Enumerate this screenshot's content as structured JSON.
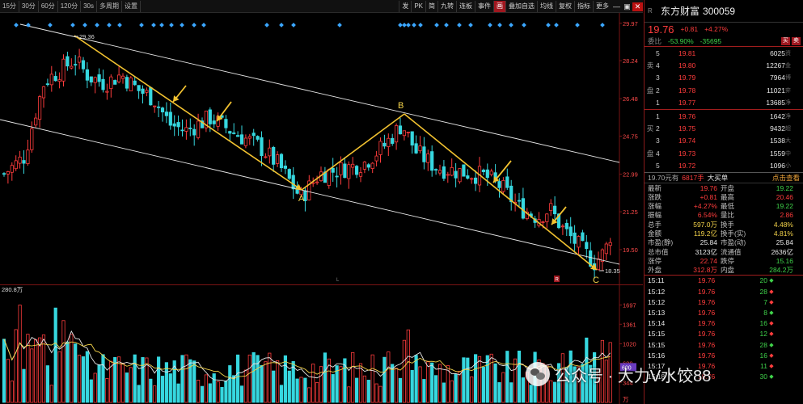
{
  "toolbar": {
    "periods": [
      "15分",
      "30分",
      "60分",
      "120分",
      "30s",
      "多周期",
      "设置"
    ],
    "right_tools": [
      "发",
      "PK",
      "简",
      "九转",
      "连板",
      "事件",
      "画",
      "叠加自选",
      "均线",
      "复权",
      "指标",
      "更多"
    ],
    "highlight_tool": "画"
  },
  "kline": {
    "price_axis": [
      "29.97",
      "28.24",
      "26.48",
      "24.75",
      "22.99",
      "21.25",
      "19.50"
    ],
    "high_label": "29.36",
    "low_label": "18.35",
    "points": {
      "A": "A",
      "B": "B",
      "C": "C"
    },
    "marker_l": "L",
    "marker_r": "R",
    "colors": {
      "up": "#ff3c3c",
      "down": "#36d7df",
      "pattern": "#f2c230",
      "channel": "#e8e8e8",
      "diamond": "#3ba7ff"
    }
  },
  "volume": {
    "top_label": "280.8万",
    "axis": [
      "1697",
      "1361",
      "1020",
      "680",
      "344"
    ],
    "unit": "万",
    "current_tag": "600"
  },
  "panel": {
    "stock_tag": "R",
    "name": "东方财富",
    "code": "300059",
    "price": "19.76",
    "change": "+0.81",
    "pct": "+4.27%",
    "wb_label": "委比",
    "wb_value": "-53.90%",
    "wc_value": "-35695",
    "btn_buy": "买",
    "btn_sell": "卖",
    "ask_side": "卖盘",
    "bid_side": "买盘",
    "asks": [
      {
        "level": "5",
        "price": "19.81",
        "vol": "6025",
        "edge": "资"
      },
      {
        "level": "4",
        "price": "19.80",
        "vol": "12267",
        "edge": "金"
      },
      {
        "level": "3",
        "price": "19.79",
        "vol": "7964",
        "edge": "博"
      },
      {
        "level": "2",
        "price": "19.78",
        "vol": "11021",
        "edge": "弈"
      },
      {
        "level": "1",
        "price": "19.77",
        "vol": "13685",
        "edge": "净"
      }
    ],
    "bids": [
      {
        "level": "1",
        "price": "19.76",
        "vol": "1642",
        "edge": "净"
      },
      {
        "level": "2",
        "price": "19.75",
        "vol": "9432",
        "edge": "超"
      },
      {
        "level": "3",
        "price": "19.74",
        "vol": "1538",
        "edge": "大"
      },
      {
        "level": "4",
        "price": "19.73",
        "vol": "1559",
        "edge": "中"
      },
      {
        "level": "5",
        "price": "19.72",
        "vol": "1096",
        "edge": "小"
      }
    ],
    "summary_left": "19.70元有",
    "summary_mid": "6817手",
    "summary_tag": "大买单",
    "summary_right": "点击查看",
    "quote": [
      {
        "k": "最新",
        "v": "19.76",
        "vc": "red",
        "k2": "开盘",
        "v2": "19.22",
        "v2c": "green"
      },
      {
        "k": "涨跌",
        "v": "+0.81",
        "vc": "red",
        "k2": "最高",
        "v2": "20.46",
        "v2c": "red"
      },
      {
        "k": "涨幅",
        "v": "+4.27%",
        "vc": "red",
        "k2": "最低",
        "v2": "19.22",
        "v2c": "green"
      },
      {
        "k": "振幅",
        "v": "6.54%",
        "vc": "red",
        "k2": "量比",
        "v2": "2.86",
        "v2c": "red"
      },
      {
        "k": "总手",
        "v": "597.0万",
        "vc": "yellow",
        "k2": "换手",
        "v2": "4.48%",
        "v2c": "yellow"
      },
      {
        "k": "金额",
        "v": "119.2亿",
        "vc": "yellow",
        "k2": "换手(实)",
        "v2": "4.81%",
        "v2c": "yellow"
      },
      {
        "k": "市盈(静)",
        "v": "25.84",
        "vc": "white",
        "k2": "市盈(动)",
        "v2": "25.84",
        "v2c": "white"
      },
      {
        "k": "总市值",
        "v": "3123亿",
        "vc": "white",
        "k2": "流通值",
        "v2": "2636亿",
        "v2c": "white"
      },
      {
        "k": "涨停",
        "v": "22.74",
        "vc": "red",
        "k2": "跌停",
        "v2": "15.16",
        "v2c": "green"
      },
      {
        "k": "外盘",
        "v": "312.8万",
        "vc": "red",
        "k2": "内盘",
        "v2": "284.2万",
        "v2c": "green"
      }
    ],
    "ticks": [
      {
        "t": "15:11",
        "p": "19.76",
        "v": "20",
        "d": "◆"
      },
      {
        "t": "15:12",
        "p": "19.76",
        "v": "28",
        "d": "◆"
      },
      {
        "t": "15:12",
        "p": "19.76",
        "v": "7",
        "d": "◆"
      },
      {
        "t": "15:13",
        "p": "19.76",
        "v": "8",
        "d": "◆"
      },
      {
        "t": "15:14",
        "p": "19.76",
        "v": "16",
        "d": "◆"
      },
      {
        "t": "15:15",
        "p": "19.76",
        "v": "12",
        "d": "◆"
      },
      {
        "t": "15:15",
        "p": "19.76",
        "v": "28",
        "d": "◆"
      },
      {
        "t": "15:16",
        "p": "19.76",
        "v": "16",
        "d": "◆"
      },
      {
        "t": "15:17",
        "p": "19.76",
        "v": "11",
        "d": "◆"
      },
      {
        "t": "15:18",
        "p": "19.76",
        "v": "30",
        "d": "◆"
      }
    ]
  },
  "watermark": "公众号 · 大力V水饺88"
}
